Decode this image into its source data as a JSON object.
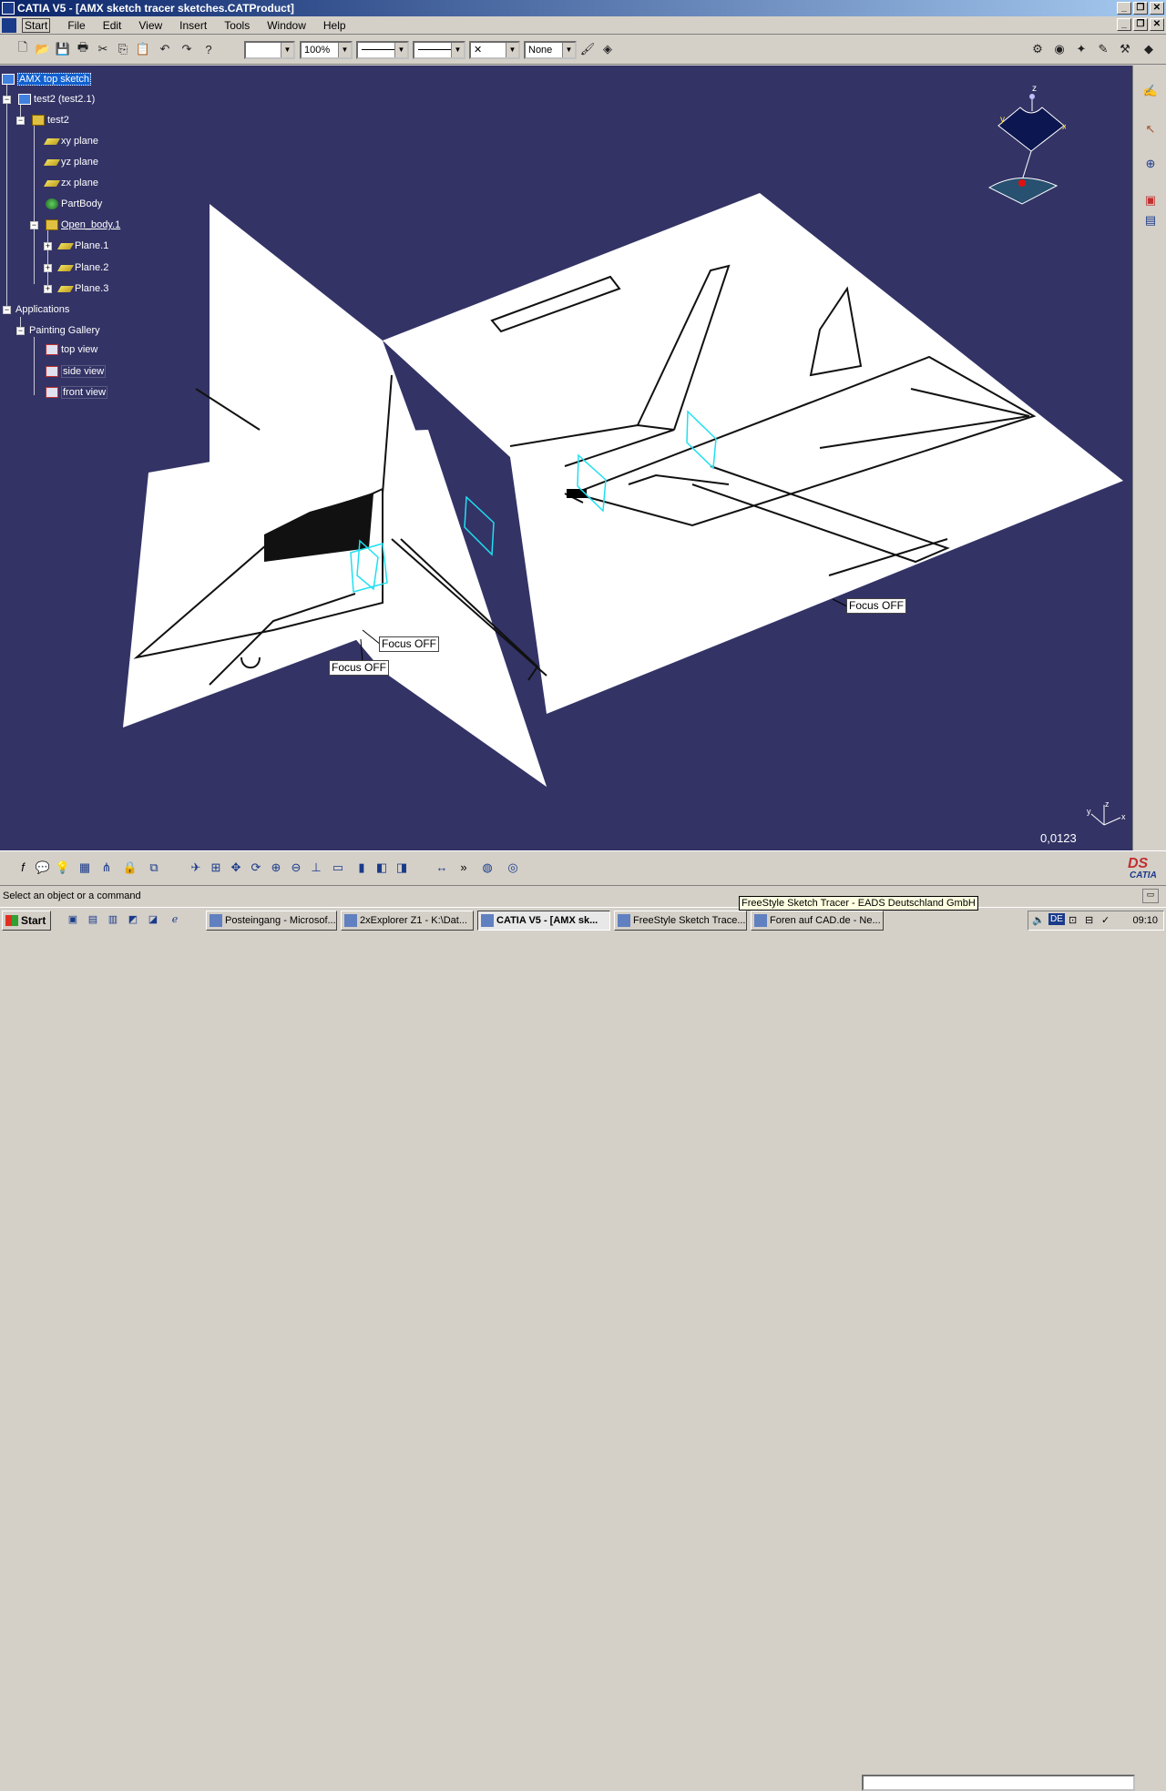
{
  "window": {
    "title": "CATIA V5 - [AMX sketch tracer sketches.CATProduct]",
    "controls": [
      "_",
      "❐",
      "✕"
    ]
  },
  "menu": {
    "items": [
      "Start",
      "File",
      "Edit",
      "View",
      "Insert",
      "Tools",
      "Window",
      "Help"
    ]
  },
  "toolbar": {
    "zoom_value": "100%",
    "point_style": "✕",
    "layer_value": "None"
  },
  "tree": {
    "root": "AMX top sketch",
    "product": "test2 (test2.1)",
    "part": "test2",
    "xy_plane": "xy plane",
    "yz_plane": "yz plane",
    "zx_plane": "zx plane",
    "part_body": "PartBody",
    "open_body": "Open_body.1",
    "plane1": "Plane.1",
    "plane2": "Plane.2",
    "plane3": "Plane.3",
    "applications": "Applications",
    "gallery": "Painting Gallery",
    "top_view": "top view",
    "side_view": "side view",
    "front_view": "front view"
  },
  "viewport": {
    "focus_label_1": "Focus OFF",
    "focus_label_2": "Focus OFF",
    "focus_label_3": "Focus OFF",
    "compass_z": "z",
    "compass_y": "y",
    "compass_x": "x",
    "axis_z": "z",
    "axis_y": "y",
    "axis_x": "x",
    "scale_value": "0,0123",
    "background_color": "#333366"
  },
  "status": {
    "message": "Select an object or a command",
    "tooltip": "FreeStyle Sketch Tracer - EADS Deutschland GmbH",
    "logo": "CATIA"
  },
  "taskbar": {
    "start_label": "Start",
    "tasks": [
      "Posteingang - Microsof...",
      "2xExplorer Z1 - K:\\Dat...",
      "CATIA V5 - [AMX sk...",
      "FreeStyle Sketch Trace...",
      "Foren auf CAD.de - Ne..."
    ],
    "lang": "DE",
    "clock": "09:10"
  }
}
